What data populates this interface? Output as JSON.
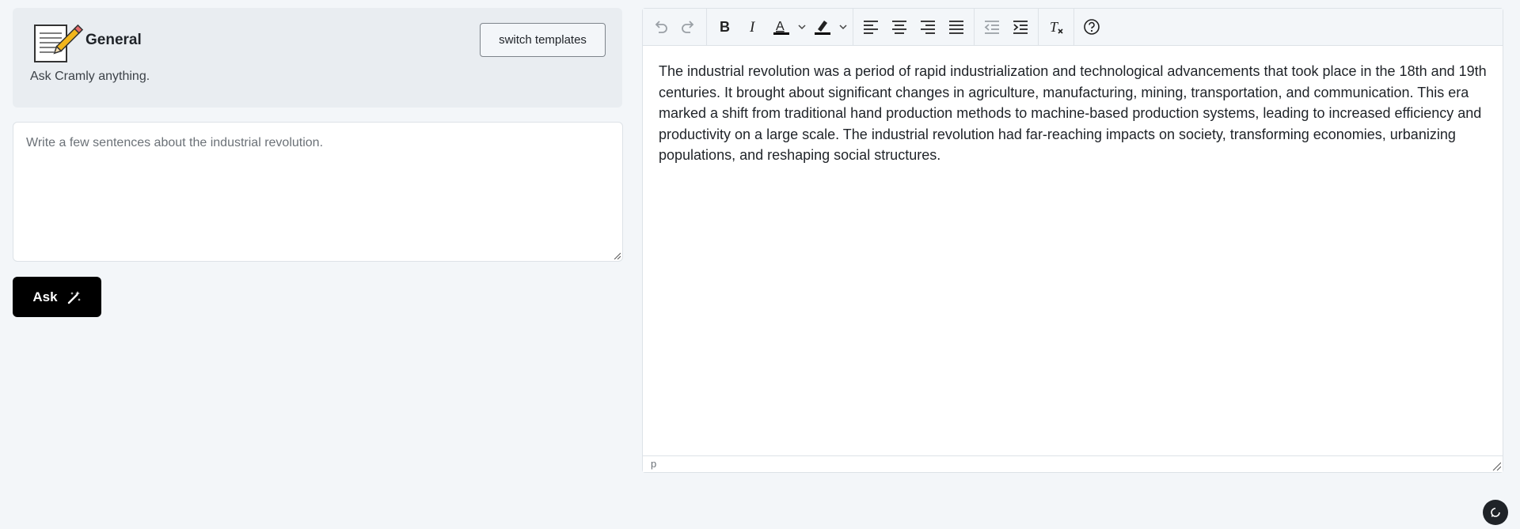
{
  "template": {
    "name": "General",
    "description": "Ask Cramly anything.",
    "switch_label": "switch templates"
  },
  "prompt": {
    "placeholder": "Write a few sentences about the industrial revolution.",
    "value": ""
  },
  "ask": {
    "label": "Ask"
  },
  "editor": {
    "toolbar_icons": [
      "undo-icon",
      "redo-icon",
      "bold-icon",
      "italic-icon",
      "text-color-icon",
      "highlight-icon",
      "align-left-icon",
      "align-center-icon",
      "align-right-icon",
      "justify-icon",
      "outdent-icon",
      "indent-icon",
      "clear-format-icon",
      "help-icon"
    ],
    "content": "The industrial revolution was a period of rapid industrialization and technological advancements that took place in the 18th and 19th centuries. It brought about significant changes in agriculture, manufacturing, mining, transportation, and communication. This era marked a shift from traditional hand production methods to machine-based production systems, leading to increased efficiency and productivity on a large scale. The industrial revolution had far-reaching impacts on society, transforming economies, urbanizing populations, and reshaping social structures.",
    "status_path": "p"
  },
  "colors": {
    "accent": "#000000",
    "background": "#f3f6f9",
    "card": "#e9edf1"
  }
}
